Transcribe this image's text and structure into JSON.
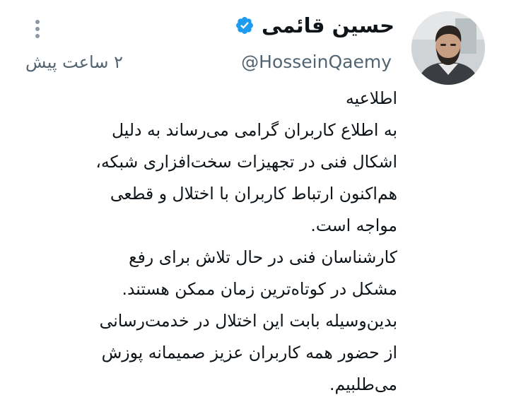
{
  "tweet": {
    "display_name": "حسین قائمی",
    "handle": "@HosseinQaemy",
    "timestamp": "۲ ساعت پیش",
    "verified": true,
    "more_icon": "more-vertical-icon",
    "accent_color": "#1d9bf0",
    "body_lines": [
      "اطلاعیه",
      "به اطلاع کاربران گرامی می‌رساند به دلیل",
      "اشکال فنی در تجهیزات سخت‌افزاری شبکه،",
      "هم‌اکنون ارتباط کاربران با اختلال و قطعی",
      "مواجه است.",
      "کارشناسان فنی در حال تلاش برای رفع",
      "مشکل در کوتاه‌ترین زمان ممکن هستند.",
      "بدین‌وسیله بابت این اختلال در خدمت‌رسانی",
      "از حضور همه کاربران عزیز صمیمانه پوزش",
      "می‌طلبیم."
    ]
  }
}
